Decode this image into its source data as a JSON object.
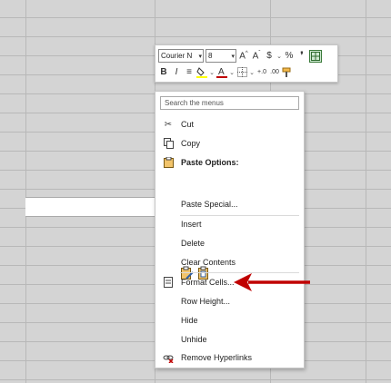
{
  "mini_toolbar": {
    "font_name": "Courier N",
    "font_size": "8",
    "buttons_row1": [
      {
        "name": "increase-font-size-button",
        "glyph": "A^"
      },
      {
        "name": "decrease-font-size-button",
        "glyph": "Aˇ"
      },
      {
        "name": "accounting-format-button",
        "glyph": "$"
      },
      {
        "name": "percent-style-button",
        "glyph": "%"
      },
      {
        "name": "comma-style-button",
        "glyph": "❜"
      }
    ],
    "buttons_row2": [
      {
        "name": "bold-button",
        "glyph": "B"
      },
      {
        "name": "italic-button",
        "glyph": "I"
      },
      {
        "name": "align-center-button",
        "glyph": "≡"
      }
    ]
  },
  "search": {
    "placeholder": "Search the menus"
  },
  "menu": {
    "cut": "Cut",
    "copy": "Copy",
    "paste_options": "Paste Options:",
    "paste_special": "Paste Special...",
    "insert": "Insert",
    "delete": "Delete",
    "clear_contents": "Clear Contents",
    "format_cells": "Format Cells...",
    "row_height": "Row Height...",
    "hide": "Hide",
    "unhide": "Unhide",
    "remove_hyperlinks": "Remove Hyperlinks"
  },
  "colors": {
    "arrow": "#c00000",
    "highlight_fill": "#ffff00",
    "font_color": "#c00000",
    "sheet_bg": "#d4d4d4"
  }
}
